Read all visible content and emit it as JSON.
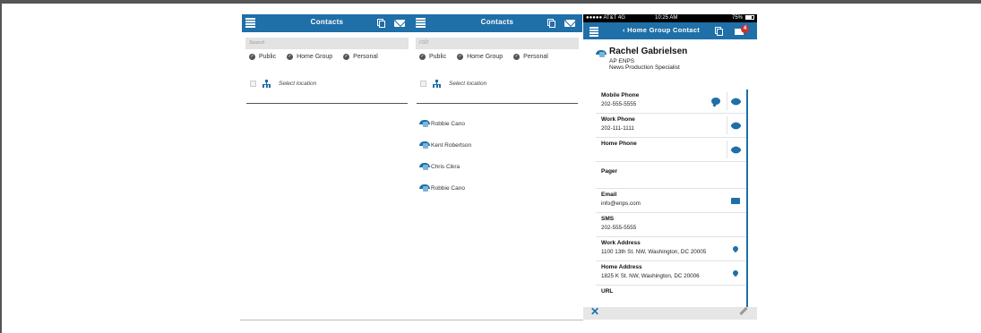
{
  "colors": {
    "accent": "#1f6fa8",
    "badge": "#d0312d"
  },
  "panel1": {
    "title": "Contacts",
    "search_placeholder": "Search",
    "filters": [
      "Public",
      "Home Group",
      "Personal"
    ],
    "location_label": "Select location"
  },
  "panel2": {
    "title": "Contacts",
    "search_value": "rob",
    "filters": [
      "Public",
      "Home Group",
      "Personal"
    ],
    "location_label": "Select location",
    "results": [
      "Robbie Cano",
      "Kent Robertson",
      "Chris Cikra",
      "Robbie Cano"
    ]
  },
  "panel3": {
    "status": {
      "carrier": "●●●●● AT&T  4G",
      "time": "10:25 AM",
      "battery": "75%"
    },
    "nav_title": "Home Group Contact",
    "badge_count": "4",
    "contact": {
      "name": "Rachel Gabrielsen",
      "org": "AP ENPS",
      "title": "News Production Specialist"
    },
    "details": [
      {
        "label": "Mobile Phone",
        "value": "202-555-5555"
      },
      {
        "label": "Work Phone",
        "value": "202-111-1111"
      },
      {
        "label": "Home Phone",
        "value": ""
      },
      {
        "label": "Pager",
        "value": ""
      },
      {
        "label": "Email",
        "value": "info@enps.com"
      },
      {
        "label": "SMS",
        "value": "202-555-5555"
      },
      {
        "label": "Work Address",
        "value": "1100 13th St. NW, Washington, DC 20005"
      },
      {
        "label": "Home Address",
        "value": "1825 K St. NW, Washington, DC 20006"
      },
      {
        "label": "URL",
        "value": ""
      }
    ]
  }
}
